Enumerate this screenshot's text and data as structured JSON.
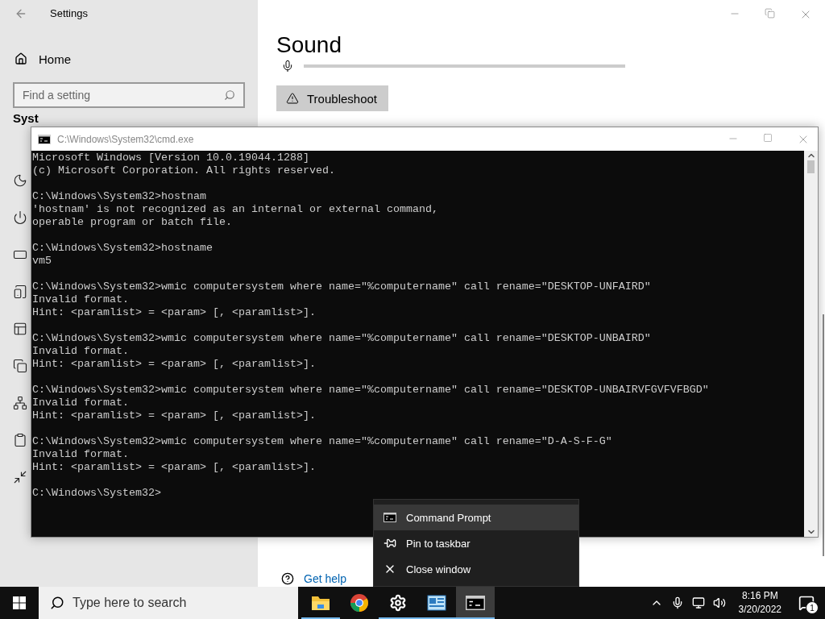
{
  "settings_window": {
    "title": "Settings",
    "nav_home": "Home",
    "search": {
      "placeholder": "Find a setting"
    },
    "section_heading": "Syst",
    "page_title": "Sound",
    "troubleshoot_button": "Troubleshoot",
    "help_link": "Get help"
  },
  "console_window": {
    "title": "C:\\Windows\\System32\\cmd.exe",
    "blocks": [
      [
        "Microsoft Windows [Version 10.0.19044.1288]",
        "(c) Microsoft Corporation. All rights reserved."
      ],
      [
        "C:\\Windows\\System32>hostnam",
        "'hostnam' is not recognized as an internal or external command,",
        "operable program or batch file."
      ],
      [
        "C:\\Windows\\System32>hostname",
        "vm5"
      ],
      [
        "C:\\Windows\\System32>wmic computersystem where name=\"%computername\" call rename=\"DESKTOP-UNFAIRD\"",
        "Invalid format.",
        "Hint: <paramlist> = <param> [, <paramlist>]."
      ],
      [
        "C:\\Windows\\System32>wmic computersystem where name=\"%computername\" call rename=\"DESKTOP-UNBAIRD\"",
        "Invalid format.",
        "Hint: <paramlist> = <param> [, <paramlist>]."
      ],
      [
        "C:\\Windows\\System32>wmic computersystem where name=\"%computername\" call rename=\"DESKTOP-UNBAIRVFGVFVFBGD\"",
        "Invalid format.",
        "Hint: <paramlist> = <param> [, <paramlist>]."
      ],
      [
        "C:\\Windows\\System32>wmic computersystem where name=\"%computername\" call rename=\"D-A-S-F-G\"",
        "Invalid format.",
        "Hint: <paramlist> = <param> [, <paramlist>]."
      ],
      [
        "C:\\Windows\\System32>"
      ]
    ]
  },
  "jump_list": {
    "items": [
      {
        "label": "Command Prompt",
        "kind": "app",
        "selected": true
      },
      {
        "label": "Pin to taskbar",
        "kind": "pin",
        "selected": false
      },
      {
        "label": "Close window",
        "kind": "close",
        "selected": false
      }
    ]
  },
  "taskbar": {
    "search": {
      "placeholder": "Type here to search"
    },
    "apps": [
      {
        "kind": "explorer",
        "running": true,
        "selected": false
      },
      {
        "kind": "browser",
        "running": false,
        "selected": false
      },
      {
        "kind": "settings",
        "running": true,
        "selected": false
      },
      {
        "kind": "control_panel",
        "running": true,
        "selected": false
      },
      {
        "kind": "console",
        "running": true,
        "selected": true
      }
    ],
    "time": "8:16 PM",
    "date": "3/20/2022",
    "notification_count": "1"
  }
}
